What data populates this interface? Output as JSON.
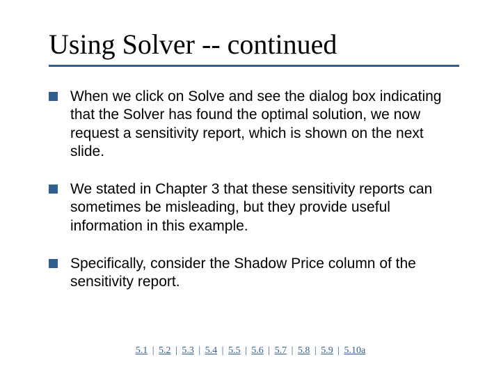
{
  "title": "Using Solver -- continued",
  "bullets": [
    "When we click on Solve and see the dialog box indicating that the Solver has found the optimal solution, we now request a sensitivity report, which is shown on the next slide.",
    "We stated in Chapter 3 that these sensitivity reports can sometimes be misleading, but they provide useful information in this example.",
    "Specifically, consider the Shadow Price column of the sensitivity report."
  ],
  "footer_links": [
    "5.1",
    "5.2",
    "5.3",
    "5.4",
    "5.5",
    "5.6",
    "5.7",
    "5.8",
    "5.9",
    "5.10a"
  ],
  "footer_separator": "|"
}
